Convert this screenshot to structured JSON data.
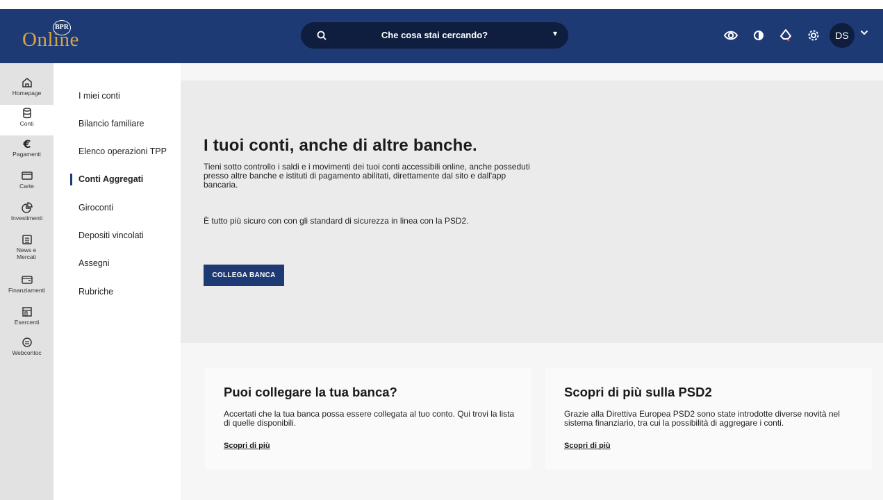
{
  "header": {
    "logo": {
      "main": "Online",
      "badge": "BPR"
    },
    "search": {
      "placeholder": "Che cosa stai cercando?"
    },
    "icons": [
      "eye-icon",
      "contrast-icon",
      "notification-icon",
      "settings-icon"
    ],
    "avatar_initials": "DS"
  },
  "rail": {
    "items": [
      {
        "label": "Homepage",
        "icon": "home-icon"
      },
      {
        "label": "Conti",
        "icon": "database-icon"
      },
      {
        "label": "Pagamenti",
        "icon": "euro-icon"
      },
      {
        "label": "Carte",
        "icon": "card-icon"
      },
      {
        "label": "Investimenti",
        "icon": "pie-chart-icon"
      },
      {
        "label": "News e Mercati",
        "icon": "news-icon"
      },
      {
        "label": "Finanziamenti",
        "icon": "wallet-icon"
      },
      {
        "label": "Esercenti",
        "icon": "store-icon"
      },
      {
        "label": "Webcontoc",
        "icon": "chat-icon"
      }
    ]
  },
  "subnav": {
    "items": [
      {
        "label": "I miei conti"
      },
      {
        "label": "Bilancio familiare"
      },
      {
        "label": "Elenco operazioni TPP"
      },
      {
        "label": "Conti Aggregati"
      },
      {
        "label": "Giroconti"
      },
      {
        "label": "Depositi vincolati"
      },
      {
        "label": "Assegni"
      },
      {
        "label": "Rubriche"
      }
    ]
  },
  "hero": {
    "title": "I tuoi conti, anche di altre banche.",
    "paragraph1": "Tieni sotto controllo i saldi e i movimenti dei tuoi conti accessibili online, anche posseduti presso altre banche e istituti di pagamento abilitati, direttamente dal sito e dall'app bancaria.",
    "paragraph2": "È tutto più sicuro con con gli standard di sicurezza in linea con la PSD2.",
    "button": "COLLEGA BANCA"
  },
  "cards": [
    {
      "title": "Puoi collegare la tua banca?",
      "text": "Accertati che la tua banca possa essere collegata al tuo conto. Qui trovi la lista di quelle disponibili.",
      "link": "Scopri di più"
    },
    {
      "title": "Scopri di più sulla PSD2",
      "text": "Grazie alla Direttiva Europea PSD2 sono state introdotte diverse novità nel sistema finanziario, tra cui la possibilità di aggregare i conti.",
      "link": "Scopri di più"
    }
  ],
  "colors": {
    "header": "#1d3a74",
    "search": "#0f1e3f",
    "rail": "#e2e2e2",
    "hero": "#ebebeb",
    "accent": "#1d3a74"
  }
}
